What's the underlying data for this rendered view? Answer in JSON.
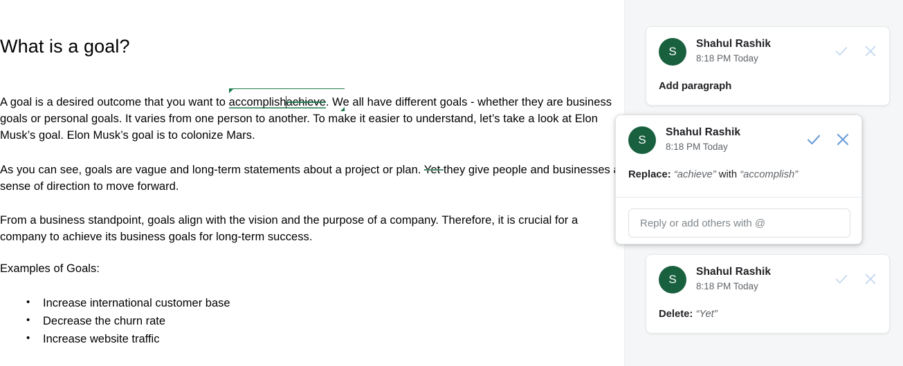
{
  "document": {
    "title": "What is a goal?",
    "paragraphs": {
      "p1_before": "A goal is a desired outcome that you want to ",
      "p1_insert": "accomplish",
      "p1_delete": "achieve",
      "p1_after": ". We all have different goals - whether they are business goals or personal goals. It varies from one person to another. To make it easier to understand, let’s take a look at Elon Musk’s goal. Elon Musk’s goal is to colonize Mars.",
      "p2_before": "As you can see, goals are vague and long-term statements about a project or plan. ",
      "p2_delete": "Yet ",
      "p2_after": "they give people and businesses a sense of direction to move forward.",
      "p3": "From a business standpoint, goals align with the vision and the purpose of a company. Therefore, it is crucial for a company to achieve its business goals for long-term success.",
      "p4": "Examples of Goals:"
    },
    "list_items": [
      "Increase international customer base",
      "Decrease the churn rate",
      "Increase website traffic"
    ]
  },
  "sidebar": {
    "cards": [
      {
        "avatar_initial": "S",
        "author": "Shahul Rashik",
        "timestamp": "8:18 PM Today",
        "body_label": "Add paragraph",
        "body_quote_1": "",
        "body_conjunction": "",
        "body_quote_2": "",
        "state": "inactive"
      },
      {
        "avatar_initial": "S",
        "author": "Shahul Rashik",
        "timestamp": "8:18 PM Today",
        "body_label": "Replace:",
        "body_quote_1": "“achieve”",
        "body_conjunction": "with",
        "body_quote_2": "“accomplish”",
        "state": "active",
        "reply_placeholder": "Reply or add others with @",
        "reply_value": ""
      },
      {
        "avatar_initial": "S",
        "author": "Shahul Rashik",
        "timestamp": "8:18 PM Today",
        "body_label": "Delete:",
        "body_quote_1": "“Yet”",
        "body_conjunction": "",
        "body_quote_2": "",
        "state": "inactive"
      }
    ],
    "icons": {
      "accept": "check-icon",
      "reject": "close-icon"
    }
  },
  "colors": {
    "suggestion_green": "#1d7a4d",
    "avatar_green": "#19603f",
    "accept_active_blue": "#6a9bd8",
    "accept_inactive_blue": "#c5d9f1",
    "sidebar_bg": "#f5f6f7"
  }
}
